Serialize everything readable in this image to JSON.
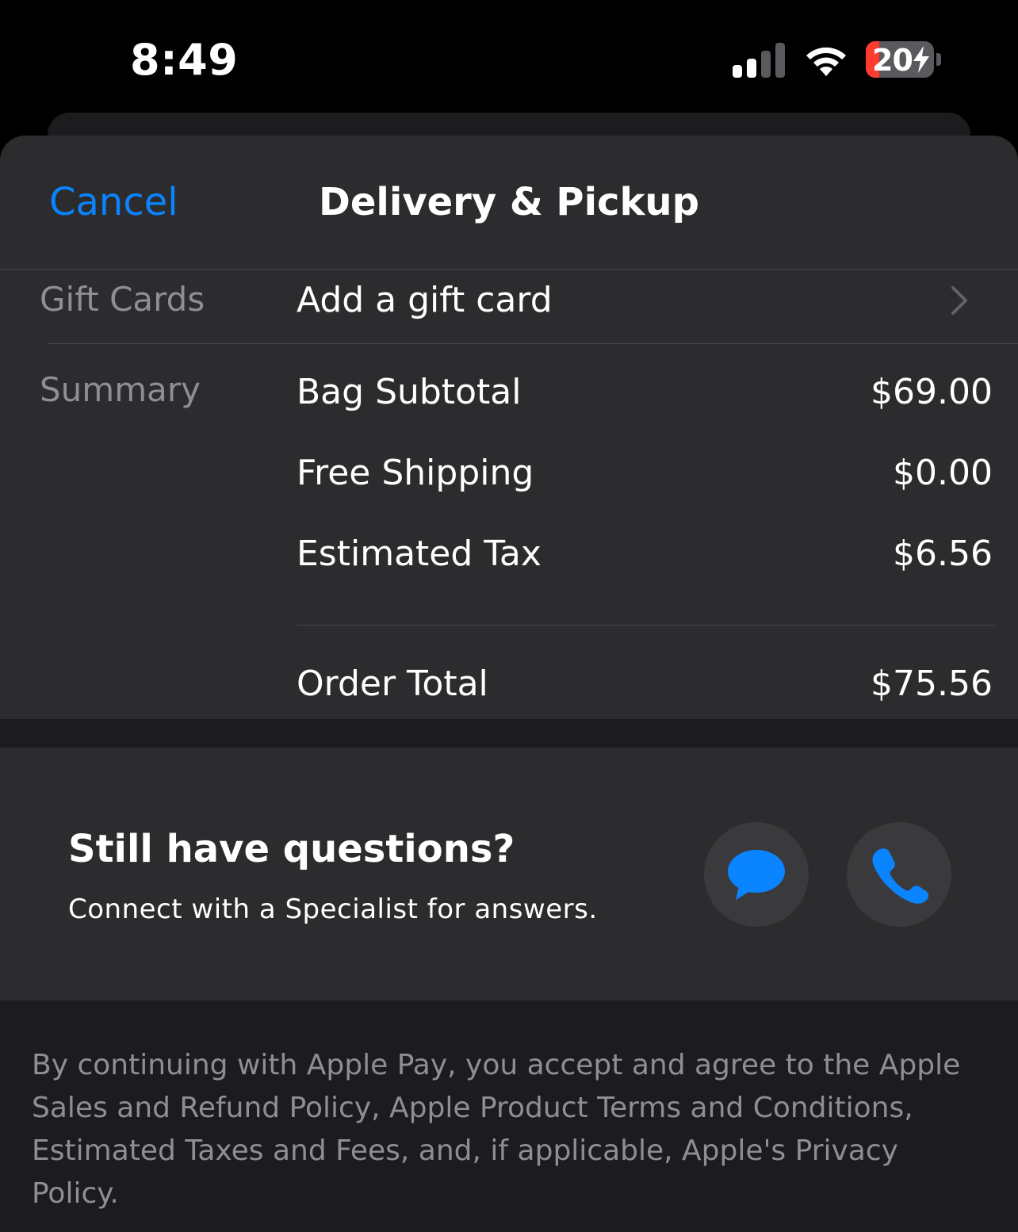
{
  "status_bar": {
    "time": "8:49",
    "battery_level": "20",
    "battery_fraction": 0.2,
    "signal_bars_active": 2,
    "signal_bars_total": 4,
    "icons": [
      "signal-icon",
      "wifi-icon",
      "battery-icon",
      "bolt-icon"
    ]
  },
  "header": {
    "cancel_label": "Cancel",
    "title": "Delivery & Pickup"
  },
  "gift_cards": {
    "section_label": "Gift Cards",
    "action_label": "Add a gift card"
  },
  "summary": {
    "section_label": "Summary",
    "rows": [
      {
        "label": "Bag Subtotal",
        "value": "$69.00"
      },
      {
        "label": "Free Shipping",
        "value": "$0.00"
      },
      {
        "label": "Estimated Tax",
        "value": "$6.56"
      }
    ],
    "total": {
      "label": "Order Total",
      "value": "$75.56"
    }
  },
  "questions": {
    "title": "Still have questions?",
    "subtitle": "Connect with a Specialist for answers."
  },
  "legal": {
    "text": "By continuing with Apple Pay, you accept and agree to the Apple Sales and Refund Policy, Apple Product Terms and Conditions, Estimated Taxes and Fees, and, if applicable, Apple's Privacy Policy."
  },
  "colors": {
    "accent": "#0a84ff",
    "sheet_background": "#2c2c2e",
    "page_background": "#1c1c1e",
    "secondary_text": "#8e8e93",
    "battery_low": "#ff3b30"
  }
}
